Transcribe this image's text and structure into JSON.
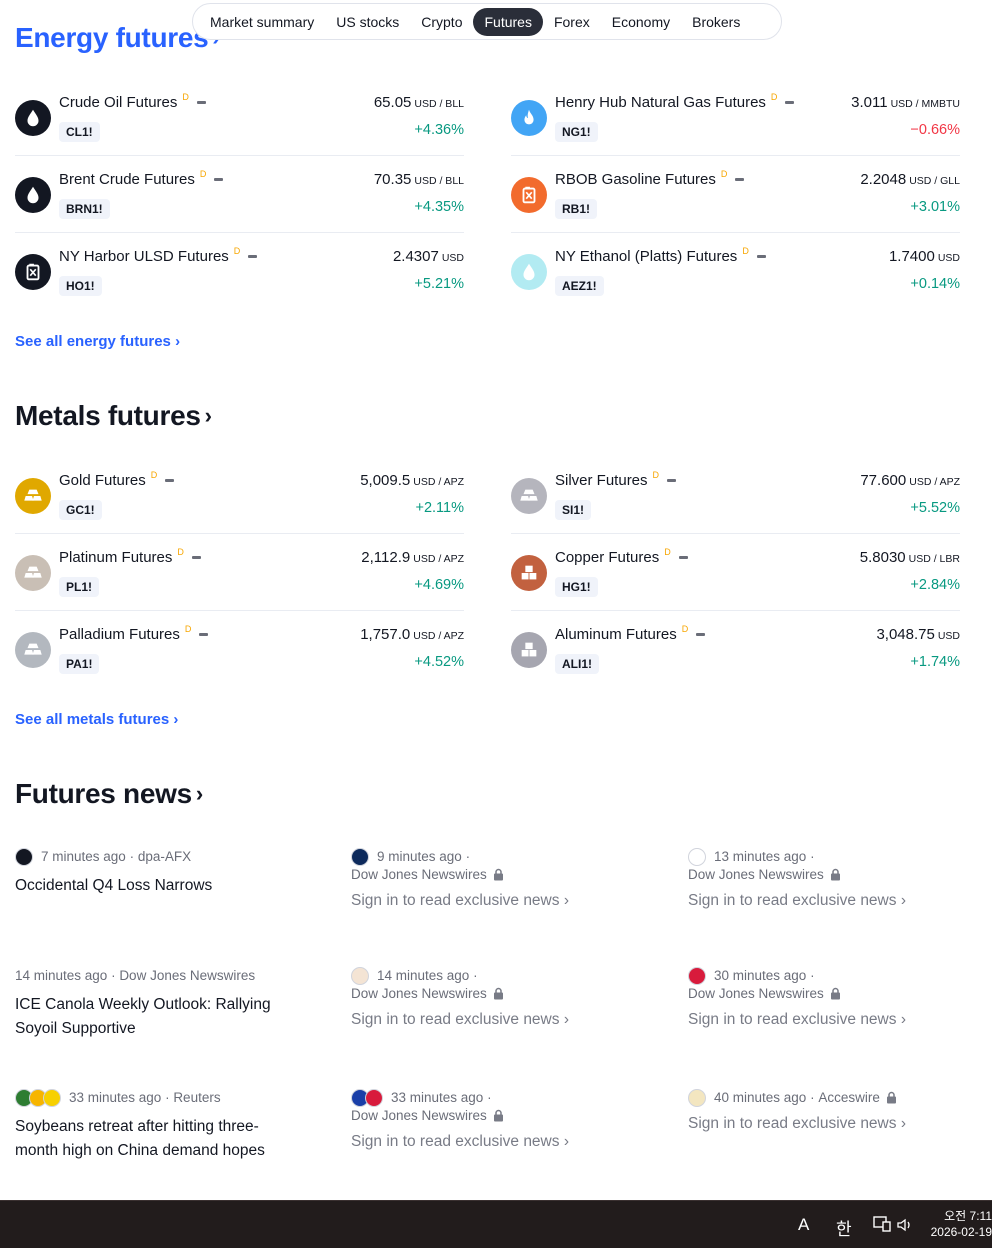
{
  "tabs": [
    "Market summary",
    "US stocks",
    "Crypto",
    "Futures",
    "Forex",
    "Economy",
    "Brokers"
  ],
  "active_tab": "Futures",
  "energy": {
    "title": "Energy futures",
    "see_all": "See all energy futures",
    "items": [
      {
        "name": "Crude Oil Futures",
        "ticker": "CL1!",
        "price": "65.05",
        "unit": "USD / BLL",
        "change": "+4.36%",
        "dir": "pos",
        "icon": "oil-drop-icon",
        "color": "#131722"
      },
      {
        "name": "Henry Hub Natural Gas Futures",
        "ticker": "NG1!",
        "price": "3.011",
        "unit": "USD / MMBTU",
        "change": "−0.66%",
        "dir": "neg",
        "icon": "flame-icon",
        "color": "#42a5f5"
      },
      {
        "name": "Brent Crude Futures",
        "ticker": "BRN1!",
        "price": "70.35",
        "unit": "USD / BLL",
        "change": "+4.35%",
        "dir": "pos",
        "icon": "oil-drop-icon",
        "color": "#131722"
      },
      {
        "name": "RBOB Gasoline Futures",
        "ticker": "RB1!",
        "price": "2.2048",
        "unit": "USD / GLL",
        "change": "+3.01%",
        "dir": "pos",
        "icon": "fuel-can-icon",
        "color": "#f26b2d"
      },
      {
        "name": "NY Harbor ULSD Futures",
        "ticker": "HO1!",
        "price": "2.4307",
        "unit": "USD",
        "change": "+5.21%",
        "dir": "pos",
        "icon": "fuel-can-icon",
        "color": "#131722"
      },
      {
        "name": "NY Ethanol (Platts) Futures",
        "ticker": "AEZ1!",
        "price": "1.7400",
        "unit": "USD",
        "change": "+0.14%",
        "dir": "pos",
        "icon": "water-drop-icon",
        "color": "#b2ebf2"
      }
    ]
  },
  "metals": {
    "title": "Metals futures",
    "see_all": "See all metals futures",
    "items": [
      {
        "name": "Gold Futures",
        "ticker": "GC1!",
        "price": "5,009.5",
        "unit": "USD / APZ",
        "change": "+2.11%",
        "dir": "pos",
        "icon": "gold-bars-icon",
        "color": "#e0a800"
      },
      {
        "name": "Silver Futures",
        "ticker": "SI1!",
        "price": "77.600",
        "unit": "USD / APZ",
        "change": "+5.52%",
        "dir": "pos",
        "icon": "silver-bars-icon",
        "color": "#b5b5bd"
      },
      {
        "name": "Platinum Futures",
        "ticker": "PL1!",
        "price": "2,112.9",
        "unit": "USD / APZ",
        "change": "+4.69%",
        "dir": "pos",
        "icon": "platinum-bars-icon",
        "color": "#c9bfb5"
      },
      {
        "name": "Copper Futures",
        "ticker": "HG1!",
        "price": "5.8030",
        "unit": "USD / LBR",
        "change": "+2.84%",
        "dir": "pos",
        "icon": "copper-cubes-icon",
        "color": "#c2613f"
      },
      {
        "name": "Palladium Futures",
        "ticker": "PA1!",
        "price": "1,757.0",
        "unit": "USD / APZ",
        "change": "+4.52%",
        "dir": "pos",
        "icon": "palladium-bars-icon",
        "color": "#b3b8bf"
      },
      {
        "name": "Aluminum Futures",
        "ticker": "ALI1!",
        "price": "3,048.75",
        "unit": "USD",
        "change": "+1.74%",
        "dir": "pos",
        "icon": "aluminum-cubes-icon",
        "color": "#a6a6b0"
      }
    ]
  },
  "news": {
    "title": "Futures news",
    "items": [
      {
        "time": "7 minutes ago",
        "source": "dpa-AFX",
        "headline": "Occidental Q4 Loss Narrows",
        "locked": false
      },
      {
        "time": "9 minutes ago",
        "source": "Dow Jones Newswires",
        "headline": "Sign in to read exclusive news",
        "locked": true
      },
      {
        "time": "13 minutes ago",
        "source": "Dow Jones Newswires",
        "headline": "Sign in to read exclusive news",
        "locked": true
      },
      {
        "time": "14 minutes ago",
        "source": "Dow Jones Newswires",
        "headline": "ICE Canola Weekly Outlook: Rallying Soyoil Supportive",
        "locked": false
      },
      {
        "time": "14 minutes ago",
        "source": "Dow Jones Newswires",
        "headline": "Sign in to read exclusive news",
        "locked": true
      },
      {
        "time": "30 minutes ago",
        "source": "Dow Jones Newswires",
        "headline": "Sign in to read exclusive news",
        "locked": true
      },
      {
        "time": "33 minutes ago",
        "source": "Reuters",
        "headline": "Soybeans retreat after hitting three-month high on China demand hopes",
        "locked": false
      },
      {
        "time": "33 minutes ago",
        "source": "Dow Jones Newswires",
        "headline": "Sign in to read exclusive news",
        "locked": true
      },
      {
        "time": "40 minutes ago",
        "source": "Acceswire",
        "headline": "Sign in to read exclusive news",
        "locked": true
      }
    ]
  },
  "taskbar": {
    "ime_lang": "A",
    "ime_kor": "한",
    "time": "오전 7:11",
    "date": "2026-02-19"
  }
}
